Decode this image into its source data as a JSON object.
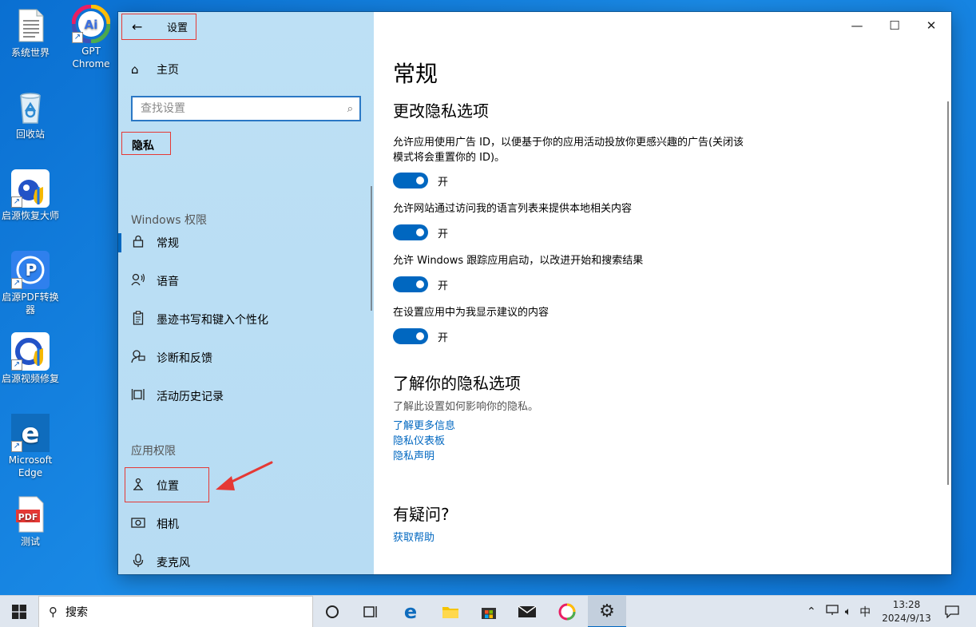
{
  "desktop": {
    "icons": [
      {
        "label": "系统世界",
        "icon": "document-icon"
      },
      {
        "label": "GPT Chrome",
        "icon": "ai-chrome-icon",
        "badge": "Ai"
      },
      {
        "label": "回收站",
        "icon": "recycle-bin-icon"
      },
      {
        "label": "启源恢复大师",
        "icon": "recovery-app-icon"
      },
      {
        "label": "启源PDF转换器",
        "icon": "pdf-converter-icon",
        "badge": "P"
      },
      {
        "label": "启源视频修复",
        "icon": "video-repair-icon"
      },
      {
        "label": "Microsoft Edge",
        "icon": "edge-icon",
        "badge": "e"
      },
      {
        "label": "测试",
        "icon": "pdf-file-icon",
        "badge": "PDF"
      }
    ]
  },
  "window": {
    "title": "设置",
    "nav": {
      "home": "主页",
      "search_placeholder": "查找设置",
      "section": "隐私",
      "group_windows": "Windows 权限",
      "windows_items": [
        {
          "label": "常规",
          "icon": "lock-icon"
        },
        {
          "label": "语音",
          "icon": "speech-icon"
        },
        {
          "label": "墨迹书写和键入个性化",
          "icon": "clipboard-icon"
        },
        {
          "label": "诊断和反馈",
          "icon": "feedback-icon"
        },
        {
          "label": "活动历史记录",
          "icon": "activity-history-icon"
        }
      ],
      "group_apps": "应用权限",
      "app_items": [
        {
          "label": "位置",
          "icon": "location-icon"
        },
        {
          "label": "相机",
          "icon": "camera-icon"
        },
        {
          "label": "麦克风",
          "icon": "microphone-icon"
        }
      ]
    },
    "content": {
      "heading": "常规",
      "subheading": "更改隐私选项",
      "settings": [
        {
          "text": "允许应用使用广告 ID，以便基于你的应用活动投放你更感兴趣的广告(关闭该模式将会重置你的 ID)。",
          "state": "开",
          "on": true
        },
        {
          "text": "允许网站通过访问我的语言列表来提供本地相关内容",
          "state": "开",
          "on": true
        },
        {
          "text": "允许 Windows 跟踪应用启动，以改进开始和搜索结果",
          "state": "开",
          "on": true
        },
        {
          "text": "在设置应用中为我显示建议的内容",
          "state": "开",
          "on": true
        }
      ],
      "learn_heading": "了解你的隐私选项",
      "learn_desc": "了解此设置如何影响你的隐私。",
      "links": [
        "了解更多信息",
        "隐私仪表板",
        "隐私声明"
      ],
      "question_heading": "有疑问?",
      "help_link": "获取帮助"
    }
  },
  "taskbar": {
    "search_label": "搜索",
    "tray": {
      "ime": "中",
      "time": "13:28",
      "date": "2024/9/13"
    }
  },
  "colors": {
    "accent": "#0067c0",
    "annotation": "#e53935",
    "nav_bg": "#bde0f5"
  }
}
